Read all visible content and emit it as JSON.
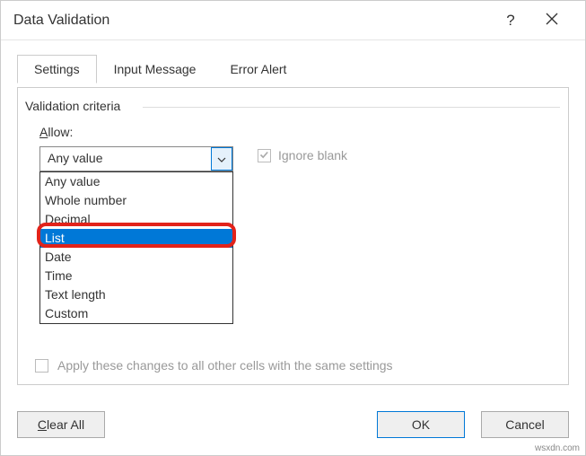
{
  "title": "Data Validation",
  "help_label": "?",
  "tabs": {
    "settings": "Settings",
    "input_message": "Input Message",
    "error_alert": "Error Alert"
  },
  "fieldset_label": "Validation criteria",
  "allow_label_prefix": "A",
  "allow_label_rest": "llow:",
  "combo_value": "Any value",
  "ignore_blank_label": "Ignore blank",
  "list_items": [
    "Any value",
    "Whole number",
    "Decimal",
    "List",
    "Date",
    "Time",
    "Text length",
    "Custom"
  ],
  "selected_index": 3,
  "apply_label": "Apply these changes to all other cells with the same settings",
  "buttons": {
    "clear_prefix": "C",
    "clear_rest": "lear All",
    "ok": "OK",
    "cancel": "Cancel"
  },
  "watermark": "wsxdn.com"
}
